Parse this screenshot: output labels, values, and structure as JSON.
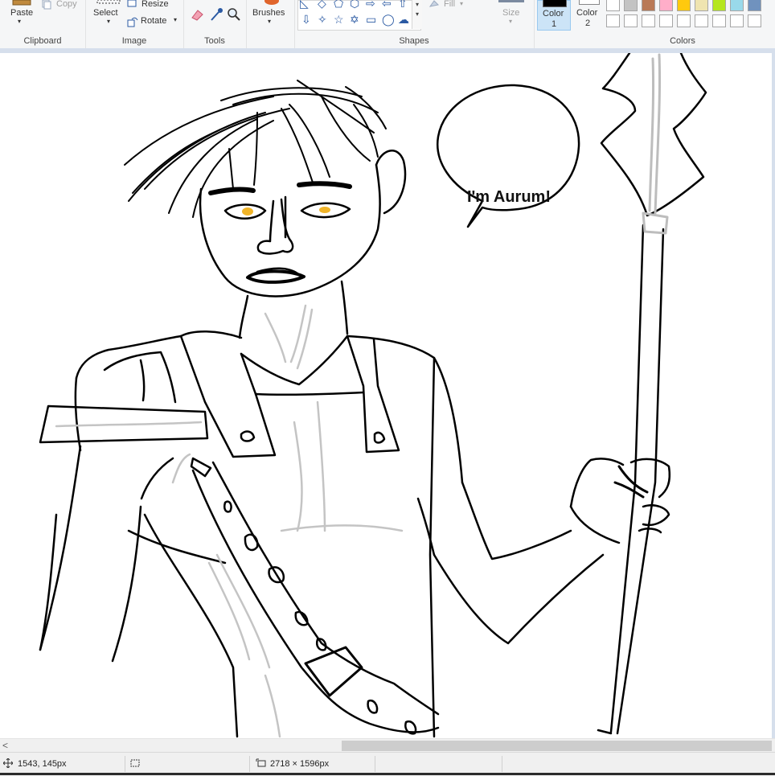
{
  "ribbon": {
    "clipboard": {
      "paste_label": "Paste",
      "copy_label": "Copy",
      "group_label": "Clipboard"
    },
    "image": {
      "select_label": "Select",
      "resize_label": "Resize",
      "rotate_label": "Rotate",
      "group_label": "Image"
    },
    "tools": {
      "group_label": "Tools"
    },
    "brushes": {
      "label": "Brushes"
    },
    "shapes": {
      "fill_label": "Fill",
      "group_label": "Shapes"
    },
    "size": {
      "label": "Size"
    },
    "color1": {
      "label_line1": "Color",
      "label_line2": "1",
      "color": "#000000"
    },
    "color2": {
      "label_line1": "Color",
      "label_line2": "2",
      "color": "#ffffff"
    },
    "colors": {
      "group_label": "Colors",
      "row1": [
        "#ffffff",
        "#c3c3c3",
        "#b97a57",
        "#ffaec9",
        "#ffc90e",
        "#efe4b0",
        "#b5e61d",
        "#99d9ea",
        "#7092be"
      ],
      "row2": [
        "#ffffff",
        "#ffffff",
        "#ffffff",
        "#ffffff",
        "#ffffff",
        "#ffffff",
        "#ffffff",
        "#ffffff",
        "#ffffff"
      ]
    }
  },
  "canvas": {
    "speech_bubble_text": "I'm Aurum!"
  },
  "status": {
    "cursor_position": "1543, 145px",
    "image_size": "2718 × 1596px"
  },
  "scrollbar": {
    "left_arrow": "<"
  }
}
